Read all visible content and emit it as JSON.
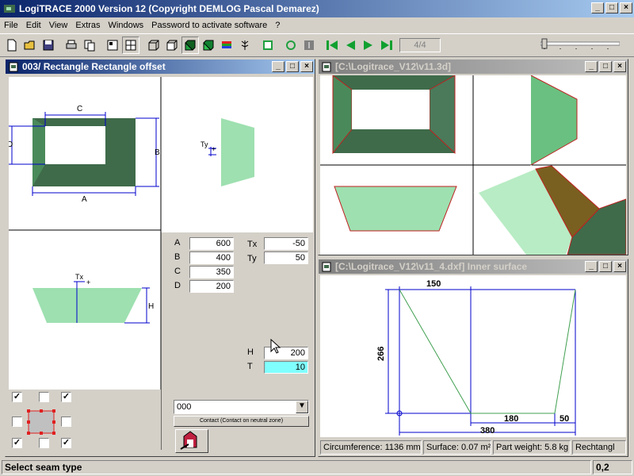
{
  "app": {
    "title": "LogiTRACE 2000  Version 12  (Copyright DEMLOG Pascal Demarez)"
  },
  "menu": [
    "File",
    "Edit",
    "View",
    "Extras",
    "Windows",
    "Password to activate software",
    "?"
  ],
  "toolbar": {
    "page_indicator": "4/4"
  },
  "win_left": {
    "title": "003/ Rectangle Rectangle offset",
    "drawing": {
      "label_c": "C",
      "label_b": "B",
      "label_a": "A",
      "label_d": "D",
      "label_ty": "Ty",
      "label_tx": "Tx",
      "label_h": "H"
    },
    "params": {
      "a_label": "A",
      "a_value": "600",
      "b_label": "B",
      "b_value": "400",
      "c_label": "C",
      "c_value": "350",
      "d_label": "D",
      "d_value": "200",
      "tx_label": "Tx",
      "tx_value": "-50",
      "ty_label": "Ty",
      "ty_value": "50",
      "h_label": "H",
      "h_value": "200",
      "t_label": "T",
      "t_value": "10"
    },
    "contact_select": "000",
    "contact_button": "Contact (Contact on neutral zone)"
  },
  "win_3d": {
    "title": "[C:\\Logitrace_V12\\v11.3d]"
  },
  "win_dxf": {
    "title": "[C:\\Logitrace_V12\\v11_4.dxf]  Inner surface",
    "dims": {
      "top": "150",
      "left": "266",
      "bottom_mid": "180",
      "bottom_right": "50",
      "bottom_total": "380"
    },
    "info": {
      "circumference": "Circumference: 1136 mm",
      "surface": "Surface: 0.07 m²",
      "weight": "Part weight: 5.8 kg",
      "type": "Rechtangl"
    }
  },
  "status": {
    "message": "Select seam type",
    "value": "0,2"
  },
  "colors": {
    "title_active": "#0a246a",
    "dark_green": "#3f6b4a",
    "light_green": "#9ee0b0",
    "dim_blue": "#0000cc"
  }
}
